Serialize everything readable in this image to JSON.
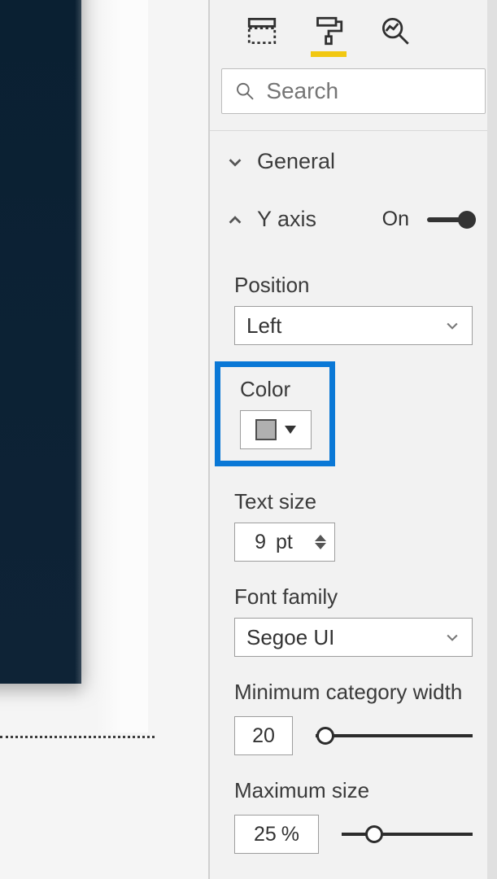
{
  "search": {
    "placeholder": "Search"
  },
  "sections": {
    "general": {
      "label": "General"
    },
    "yaxis": {
      "label": "Y axis",
      "toggleLabel": "On"
    }
  },
  "yaxis": {
    "position": {
      "label": "Position",
      "value": "Left"
    },
    "color": {
      "label": "Color",
      "swatch": "#b0b0b0"
    },
    "textSize": {
      "label": "Text size",
      "value": "9",
      "unit": "pt"
    },
    "fontFamily": {
      "label": "Font family",
      "value": "Segoe UI"
    },
    "minCatW": {
      "label": "Minimum category width",
      "value": "20"
    },
    "maxSize": {
      "label": "Maximum size",
      "value": "25",
      "unit": "%"
    }
  }
}
